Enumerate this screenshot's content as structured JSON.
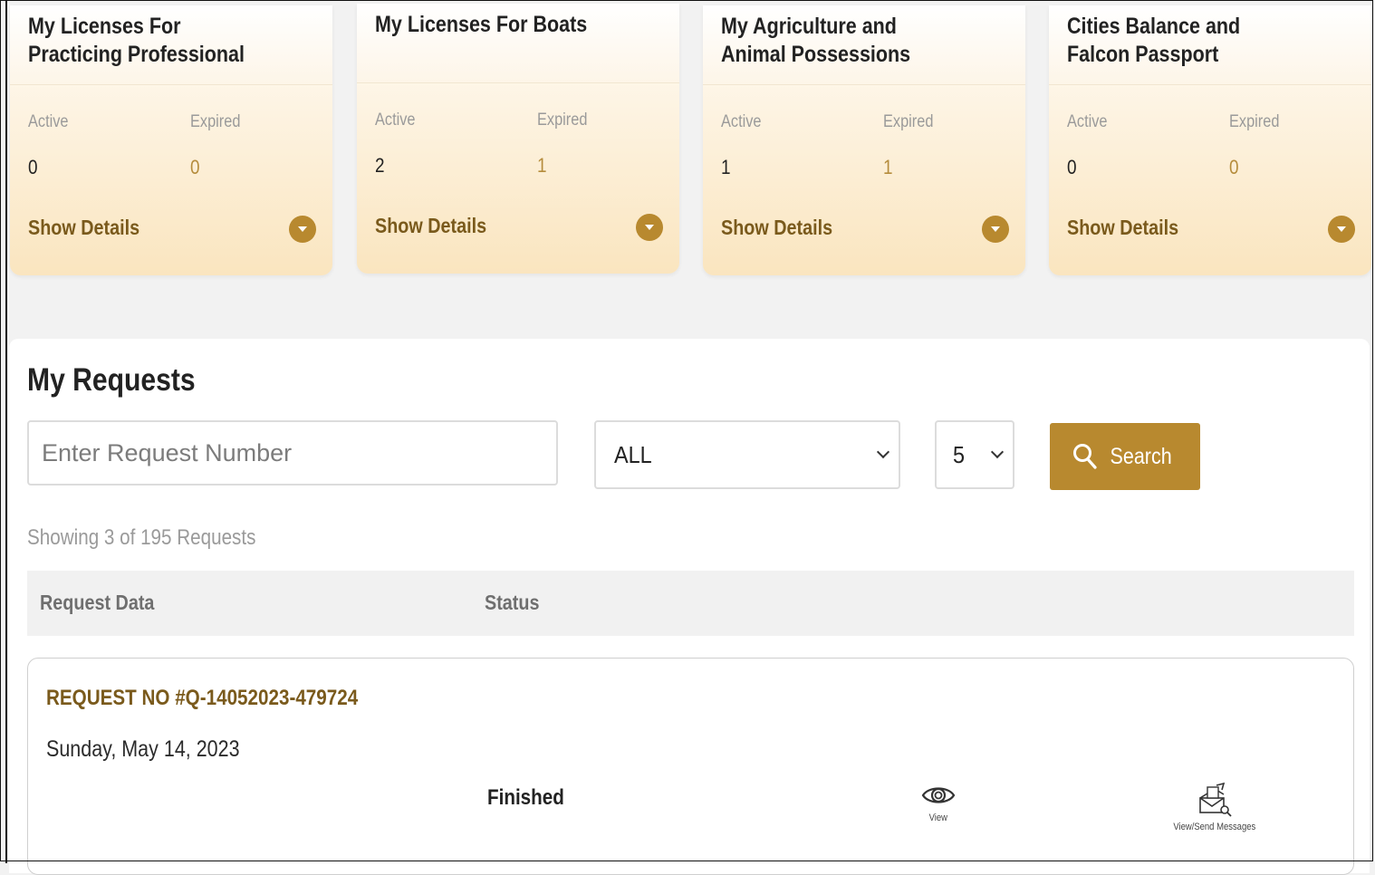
{
  "cards": [
    {
      "title_line1": "My Licenses For",
      "title_line2": "Practicing Professional",
      "active_label": "Active",
      "expired_label": "Expired",
      "active": "0",
      "expired": "0",
      "show_details": "Show Details"
    },
    {
      "title_line1": "My Licenses For Boats",
      "title_line2": "",
      "active_label": "Active",
      "expired_label": "Expired",
      "active": "2",
      "expired": "1",
      "show_details": "Show Details"
    },
    {
      "title_line1": "My Agriculture and",
      "title_line2": "Animal Possessions",
      "active_label": "Active",
      "expired_label": "Expired",
      "active": "1",
      "expired": "1",
      "show_details": "Show Details"
    },
    {
      "title_line1": "Cities Balance and",
      "title_line2": "Falcon Passport",
      "active_label": "Active",
      "expired_label": "Expired",
      "active": "0",
      "expired": "0",
      "show_details": "Show Details"
    }
  ],
  "requests": {
    "title": "My Requests",
    "search_placeholder": "Enter Request Number",
    "status_filter": "ALL",
    "page_size": "5",
    "search_label": "Search",
    "showing": "Showing 3 of 195 Requests",
    "columns": [
      "Request Data",
      "Status"
    ],
    "items": [
      {
        "number": "REQUEST NO #Q-14052023-479724",
        "date": "Sunday, May 14, 2023",
        "status": "Finished",
        "view_label": "View",
        "messages_label": "View/Send Messages"
      }
    ]
  },
  "colors": {
    "accent": "#b8892f",
    "accent_dark": "#7a5a1c"
  },
  "icons": [
    "chevron-down-icon",
    "search-icon",
    "eye-icon",
    "envelope-search-icon"
  ]
}
